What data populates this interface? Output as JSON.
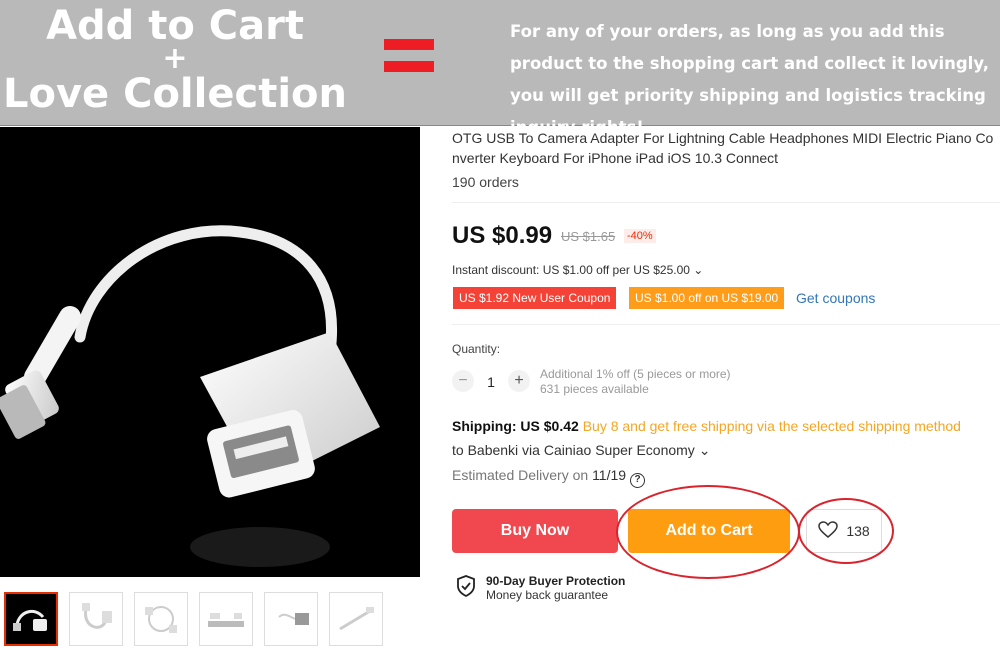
{
  "banner": {
    "line1": "Add to Cart",
    "line2": "+",
    "line3": "Love Collection",
    "message": "For any of your orders, as long as you add this product to the shopping cart and collect it lovingly, you will get priority shipping and logistics tracking inquiry rights!",
    "equals_color": "#ee1c25"
  },
  "product": {
    "title": "OTG USB To Camera Adapter For Lightning Cable Headphones MIDI Electric Piano Converter Keyboard For iPhone iPad iOS 10.3 Connect",
    "orders": "190 orders"
  },
  "pricing": {
    "price": "US $0.99",
    "old_price": "US $1.65",
    "discount": "-40%",
    "instant_discount": "Instant discount: US $1.00 off per US $25.00",
    "coupon_new_user": "US $1.92 New User Coupon",
    "coupon_off": "US $1.00 off on US $19.00",
    "get_coupons": "Get coupons"
  },
  "quantity": {
    "label": "Quantity:",
    "value": "1",
    "minus": "−",
    "plus": "+",
    "note1": "Additional 1% off (5 pieces or more)",
    "note2": "631 pieces available"
  },
  "shipping": {
    "label": "Shipping: US $0.42",
    "promo": "Buy 8 and get free shipping via the selected shipping method",
    "to": "to Babenki via Cainiao Super Economy",
    "estimated_label": "Estimated Delivery on",
    "estimated_date": "11/19"
  },
  "actions": {
    "buy_now": "Buy Now",
    "add_to_cart": "Add to Cart",
    "wishlist_count": "138"
  },
  "protection": {
    "title": "90-Day Buyer Protection",
    "subtitle": "Money back guarantee"
  },
  "colors": {
    "accent": "#f0484e",
    "cart": "#ff9d10",
    "link": "#3277b8"
  }
}
